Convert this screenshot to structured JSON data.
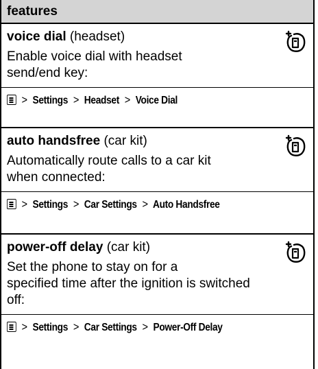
{
  "header": {
    "title": "features"
  },
  "features": [
    {
      "name": "voice dial",
      "qualifier": "(headset)",
      "description_lines": [
        "Enable voice dial with headset",
        "send/end key:"
      ],
      "path": [
        "Settings",
        "Headset",
        "Voice Dial"
      ],
      "icon": "network-subscription-icon"
    },
    {
      "name": "auto handsfree",
      "qualifier": "(car kit)",
      "description_lines": [
        "Automatically route calls to a car kit",
        "when connected:"
      ],
      "path": [
        "Settings",
        "Car Settings",
        "Auto Handsfree"
      ],
      "icon": "network-subscription-icon"
    },
    {
      "name": "power-off delay",
      "qualifier": "(car kit)",
      "description_lines": [
        "Set the phone to stay on for a",
        "specified time after the ignition is switched",
        "off:"
      ],
      "path": [
        "Settings",
        "Car Settings",
        "Power-Off Delay"
      ],
      "icon": "network-subscription-icon"
    }
  ],
  "separator": ">"
}
